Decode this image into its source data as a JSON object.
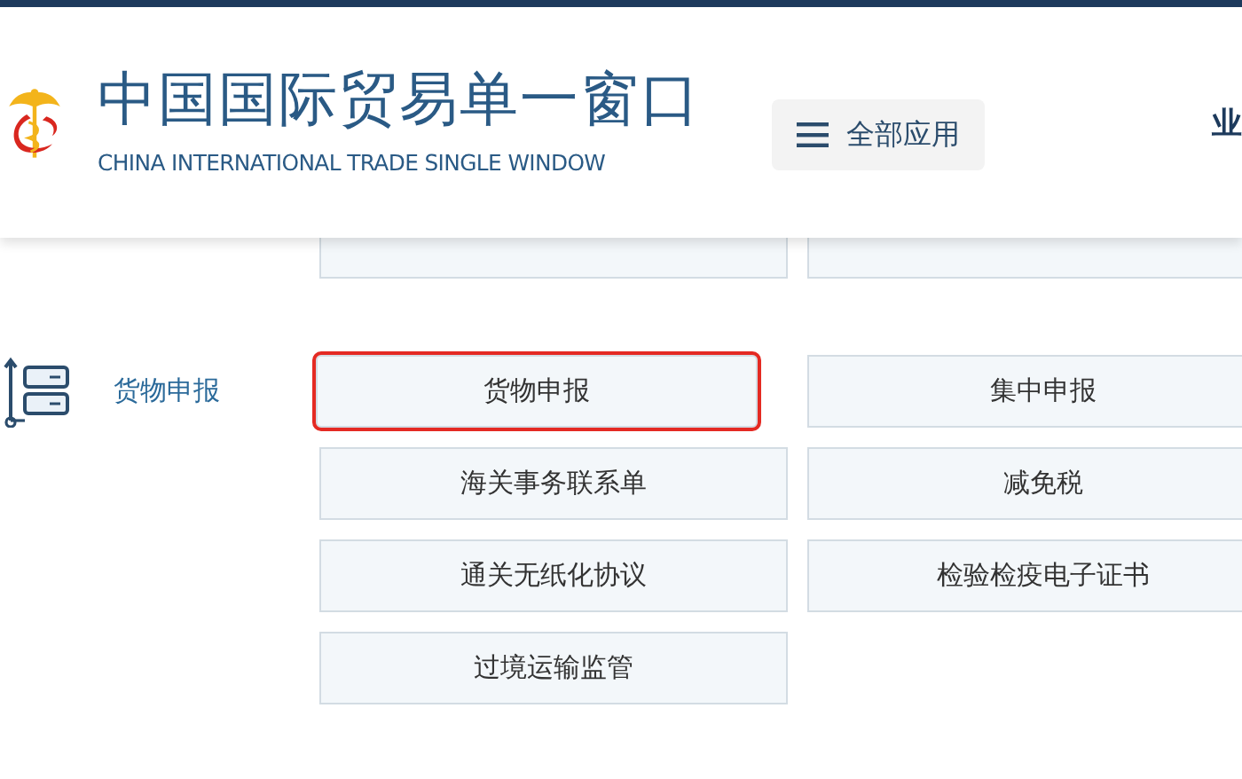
{
  "header": {
    "title": "中国国际贸易单一窗口",
    "subtitle": "CHINA INTERNATIONAL TRADE SINGLE WINDOW",
    "menu_button": "全部应用",
    "nav_items": [
      "业"
    ]
  },
  "categories": [
    {
      "items": [
        {
          "highlighted": false
        },
        {
          "highlighted": false
        }
      ]
    },
    {
      "label": "货物申报",
      "items": [
        {
          "label": "货物申报",
          "highlighted": true
        },
        {
          "label": "集中申报",
          "highlighted": false
        },
        {
          "label": "海关事务联系单",
          "highlighted": false
        },
        {
          "label": "减免税",
          "highlighted": false
        },
        {
          "label": "通关无纸化协议",
          "highlighted": false
        },
        {
          "label": "检验检疫电子证书",
          "highlighted": false
        },
        {
          "label": "过境运输监管",
          "highlighted": false
        }
      ]
    }
  ]
}
